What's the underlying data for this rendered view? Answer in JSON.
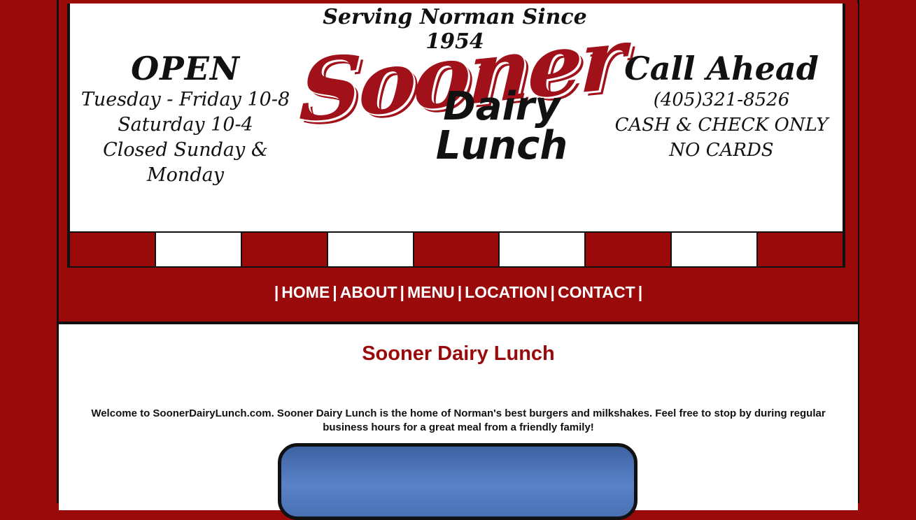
{
  "tagline": "Serving Norman Since 1954",
  "logo": {
    "word1": "Sooner",
    "word2": "Dairy",
    "word3": "Lunch"
  },
  "hours": {
    "heading": "OPEN",
    "lines": [
      "Tuesday - Friday 10-8",
      "Saturday 10-4",
      "Closed Sunday & Monday"
    ]
  },
  "contact_info": {
    "heading": "Call Ahead",
    "phone": "(405)321-8526",
    "payment": "CASH & CHECK ONLY",
    "cards": "NO CARDS"
  },
  "nav": {
    "sep": "|",
    "items": [
      "HOME",
      "ABOUT",
      "MENU",
      "LOCATION",
      "CONTACT"
    ]
  },
  "main": {
    "title": "Sooner Dairy Lunch",
    "welcome": "Welcome to SoonerDairyLunch.com. Sooner Dairy Lunch is the home of Norman's best burgers and milkshakes. Feel free to stop by during regular business hours for a great meal from a friendly family!"
  },
  "colors": {
    "brand_red": "#9a0a0a",
    "text": "#111111"
  }
}
